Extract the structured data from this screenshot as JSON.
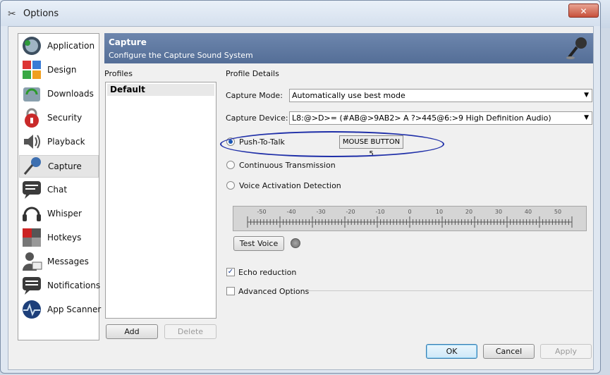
{
  "window": {
    "title": "Options",
    "close_symbol": "✕"
  },
  "sidebar": {
    "items": [
      {
        "label": "Application",
        "icon": "application-icon"
      },
      {
        "label": "Design",
        "icon": "design-icon"
      },
      {
        "label": "Downloads",
        "icon": "downloads-icon"
      },
      {
        "label": "Security",
        "icon": "security-icon"
      },
      {
        "label": "Playback",
        "icon": "playback-icon"
      },
      {
        "label": "Capture",
        "icon": "capture-icon",
        "selected": true
      },
      {
        "label": "Chat",
        "icon": "chat-icon"
      },
      {
        "label": "Whisper",
        "icon": "whisper-icon"
      },
      {
        "label": "Hotkeys",
        "icon": "hotkeys-icon"
      },
      {
        "label": "Messages",
        "icon": "messages-icon"
      },
      {
        "label": "Notifications",
        "icon": "notifications-icon"
      },
      {
        "label": "App Scanner",
        "icon": "app-scanner-icon"
      }
    ]
  },
  "header": {
    "title": "Capture",
    "subtitle": "Configure the Capture Sound System",
    "icon": "microphone-icon",
    "color": "#5f7aa3"
  },
  "profiles": {
    "label": "Profiles",
    "items": [
      "Default"
    ],
    "add_label": "Add",
    "delete_label": "Delete"
  },
  "details": {
    "label": "Profile Details",
    "capture_mode": {
      "label": "Capture Mode:",
      "value": "Automatically use best mode"
    },
    "capture_device": {
      "label": "Capture Device:",
      "value": "L8:@>D>= (#AB@>9AB2> A ?>445@6:>9 High Definition Audio)"
    },
    "push_to_talk": {
      "label": "Push-To-Talk",
      "checked": true,
      "hotkey": "MOUSE BUTTON 5"
    },
    "continuous": {
      "label": "Continuous Transmission",
      "checked": false
    },
    "vad": {
      "label": "Voice Activation Detection",
      "checked": false
    },
    "meter_ticks": [
      "-50",
      "-40",
      "-30",
      "-20",
      "-10",
      "0",
      "10",
      "20",
      "30",
      "40",
      "50"
    ],
    "test_voice_label": "Test Voice",
    "echo_reduction": {
      "label": "Echo reduction",
      "checked": true
    },
    "advanced_options": {
      "label": "Advanced Options",
      "checked": false
    }
  },
  "footer": {
    "ok_label": "OK",
    "cancel_label": "Cancel",
    "apply_label": "Apply"
  },
  "colors": {
    "annotation": "#1f2fa8",
    "ok_border": "#3c7fb1"
  }
}
